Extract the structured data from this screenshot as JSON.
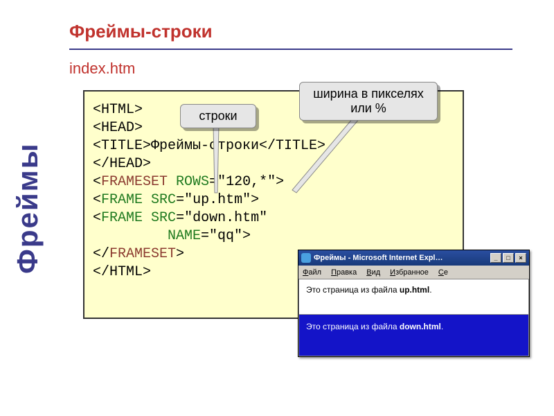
{
  "slide": {
    "title": "Фреймы-строки",
    "subtitle": "index.htm",
    "sidebar": "Фреймы"
  },
  "callouts": {
    "c1": "строки",
    "c2": "ширина в пикселях или %"
  },
  "code": {
    "l1a": "<HTML>",
    "l2a": "<HEAD>",
    "l3a": "   <TITLE>Фреймы-строки</TITLE>",
    "l4a": "</HEAD>",
    "l5a": "<",
    "l5b": "FRAMESET",
    "l5c": " ",
    "l5d": "ROWS",
    "l5e": "=\"120,*\">",
    "l6a": "   <",
    "l6b": "FRAME",
    "l6c": " ",
    "l6d": "SRC",
    "l6e": "=\"up.htm\">",
    "l7a": "   <",
    "l7b": "FRAME",
    "l7c": " ",
    "l7d": "SRC",
    "l7e": "=\"down.htm\"",
    "l8a": "         ",
    "l8b": "NAME",
    "l8c": "=\"qq\">",
    "l9a": "</",
    "l9b": "FRAMESET",
    "l9c": ">",
    "l10a": "</HTML>"
  },
  "browser": {
    "title": "Фреймы - Microsoft Internet Expl…",
    "menu": {
      "m1": "Файл",
      "m2": "Правка",
      "m3": "Вид",
      "m4": "Избранное",
      "m5": "Се"
    },
    "frameTop_a": "Это страница из файла ",
    "frameTop_b": "up.html",
    "frameTop_c": ".",
    "frameBottom_a": "Это страница из файла ",
    "frameBottom_b": "down.html",
    "frameBottom_c": ".",
    "btn_min": "_",
    "btn_max": "□",
    "btn_close": "×"
  }
}
